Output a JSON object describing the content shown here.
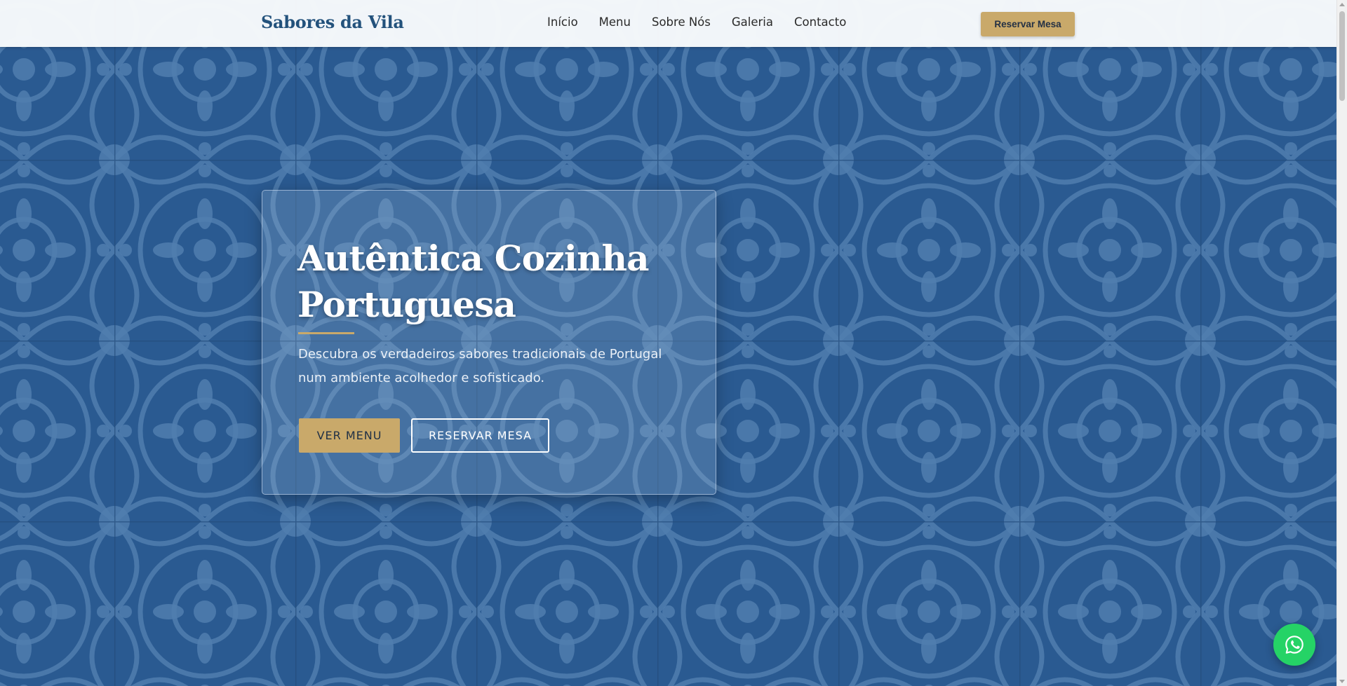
{
  "header": {
    "logo": "Sabores da Vila",
    "nav": [
      "Início",
      "Menu",
      "Sobre Nós",
      "Galeria",
      "Contacto"
    ],
    "cta_label": "Reservar Mesa"
  },
  "hero": {
    "title": "Autêntica Cozinha Portuguesa",
    "subtitle": "Descubra os verdadeiros sabores tradicionais de Portugal num ambiente acolhedor e sofisticado.",
    "primary_button": "VER MENU",
    "secondary_button": "RESERVAR MESA",
    "background": "blue-azulejo-tiles"
  },
  "floating": {
    "icon": "whatsapp-icon"
  },
  "colors": {
    "brand": "#23527c",
    "accent": "#c9a96a",
    "tile_dark": "#2e5f95",
    "tile_light": "#5b88b8",
    "whatsapp": "#25d366"
  }
}
